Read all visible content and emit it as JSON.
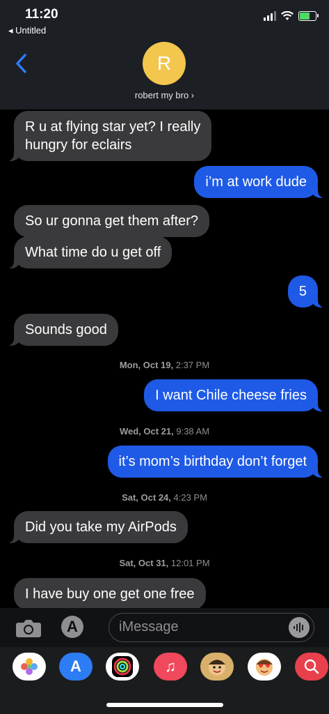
{
  "status_bar": {
    "time": "11:20",
    "back_app": "◂ Untitled"
  },
  "header": {
    "avatar_letter": "R",
    "contact_name": "robert my bro ›"
  },
  "messages": [
    {
      "dir": "in",
      "text": "R u at flying star yet? I really\nhungry for eclairs"
    },
    {
      "dir": "out",
      "text": "i’m at work dude"
    },
    {
      "dir": "in",
      "text": "So ur gonna get them after?"
    },
    {
      "dir": "in",
      "text": "What time do u get off"
    },
    {
      "dir": "out",
      "text": "5"
    },
    {
      "dir": "in",
      "text": "Sounds good"
    },
    {
      "dir": "out",
      "text": "I want Chile cheese fries"
    },
    {
      "dir": "out",
      "text": "it’s mom’s birthday don’t forget"
    },
    {
      "dir": "in",
      "text": "Did you take my AirPods"
    },
    {
      "dir": "in",
      "text": "I have buy one get one free"
    }
  ],
  "timestamps": [
    {
      "day": "Mon, Oct 19,",
      "time": " 2:37 PM"
    },
    {
      "day": "Wed, Oct 21,",
      "time": " 9:38 AM"
    },
    {
      "day": "Sat, Oct 24,",
      "time": " 4:23 PM"
    },
    {
      "day": "Sat, Oct 31,",
      "time": " 12:01 PM"
    }
  ],
  "input": {
    "placeholder": "iMessage"
  },
  "app_drawer": [
    "photos-icon",
    "app-store-icon",
    "activity-icon",
    "music-icon",
    "memoji-icon",
    "memoji-heart-eyes-icon",
    "web-search-icon"
  ],
  "colors": {
    "outgoing": "#1e5ae6",
    "incoming": "#3a3a3c",
    "avatar": "#f3c64d"
  }
}
